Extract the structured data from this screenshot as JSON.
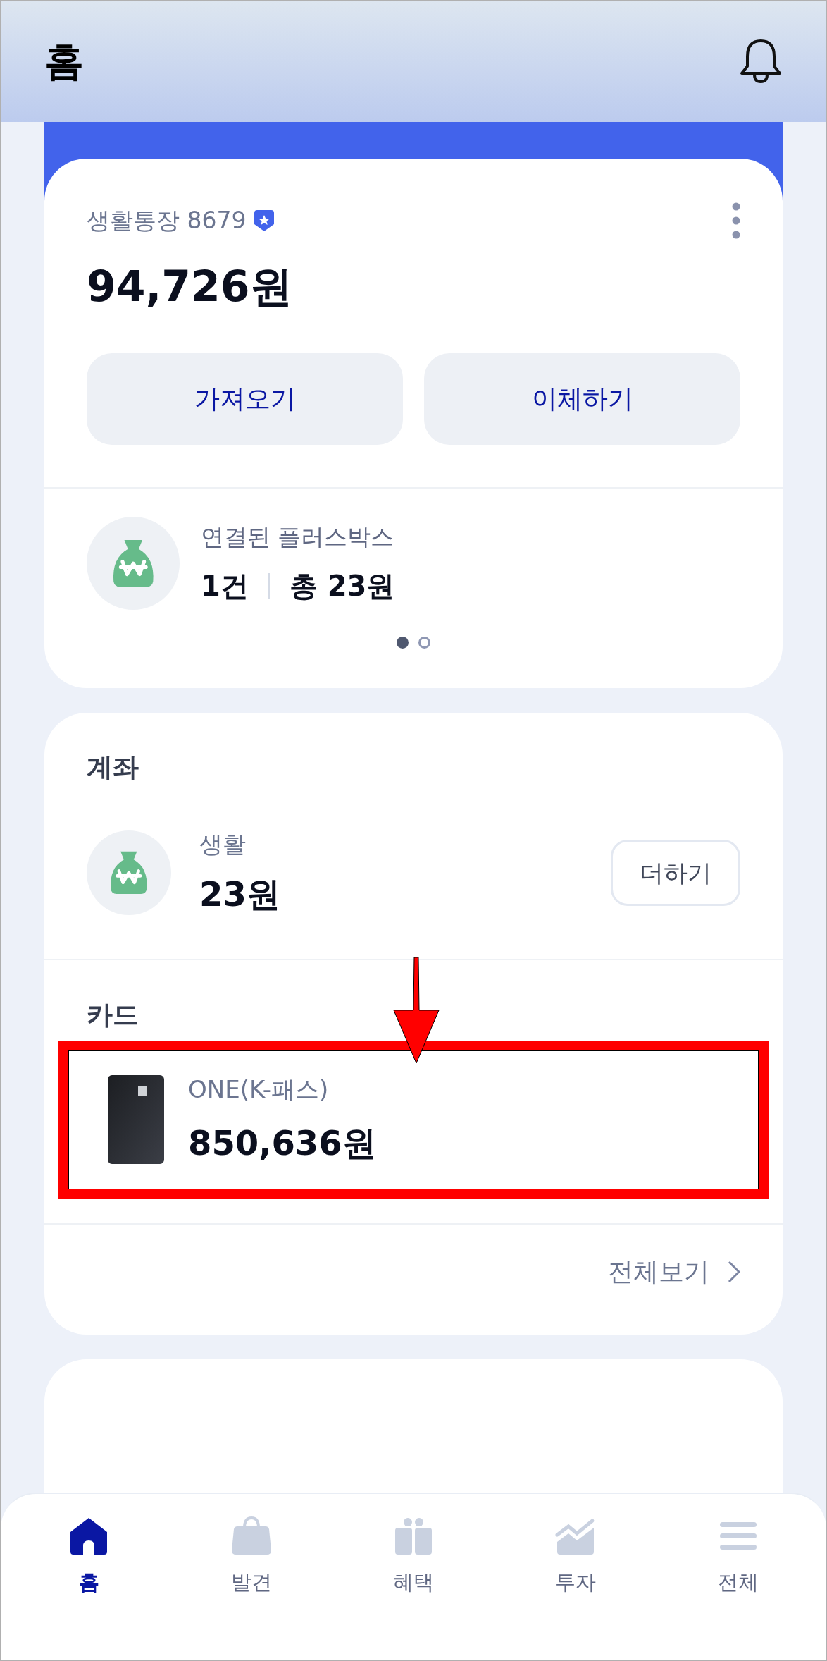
{
  "header": {
    "title": "홈"
  },
  "main_account": {
    "name": "생활통장 8679",
    "balance": "94,726원",
    "buttons": [
      "가져오기",
      "이체하기"
    ],
    "plus_box": {
      "label": "연결된 플러스박스",
      "count": "1건",
      "total": "총 23원"
    },
    "pager": [
      {
        "selected": true
      },
      {
        "selected": false
      }
    ]
  },
  "accounts": {
    "title": "계좌",
    "items": [
      {
        "name": "생활",
        "amount": "23원",
        "button": "더하기"
      }
    ]
  },
  "cards": {
    "title": "카드",
    "items": [
      {
        "name": "ONE(K-패스)",
        "amount": "850,636원",
        "highlighted": true
      }
    ]
  },
  "view_all": "전체보기",
  "tab_bar": [
    {
      "label": "홈",
      "selected": true
    },
    {
      "label": "발견",
      "selected": false
    },
    {
      "label": "혜택",
      "selected": false
    },
    {
      "label": "투자",
      "selected": false
    },
    {
      "label": "전체",
      "selected": false
    }
  ]
}
